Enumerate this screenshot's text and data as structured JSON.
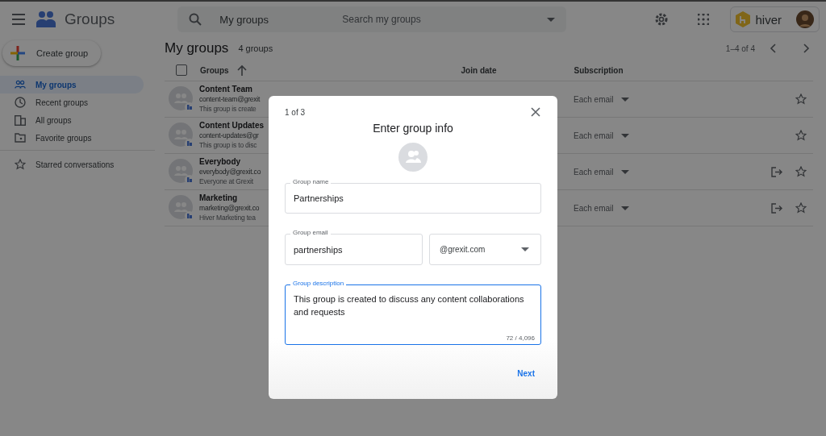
{
  "app": {
    "title": "Groups"
  },
  "search": {
    "scope": "My groups",
    "placeholder": "Search my groups"
  },
  "account": {
    "brand": "hiver"
  },
  "create_button": "Create group",
  "sidebar": {
    "items": [
      {
        "label": "My groups",
        "selected": true
      },
      {
        "label": "Recent groups",
        "selected": false
      },
      {
        "label": "All groups",
        "selected": false
      },
      {
        "label": "Favorite groups",
        "selected": false
      },
      {
        "label": "Starred conversations",
        "selected": false
      }
    ]
  },
  "page": {
    "title": "My groups",
    "count": "4 groups",
    "pagination": "1–4 of 4"
  },
  "table": {
    "columns": [
      "Groups",
      "Join date",
      "Subscription"
    ],
    "select_all": {
      "checked": false
    },
    "rows": [
      {
        "name": "Content Team",
        "email": "content-team@grexit",
        "description": "This group is create",
        "subscription": "Each email",
        "leave": false
      },
      {
        "name": "Content Updates",
        "email": "content-updates@gr",
        "description": "This group is to disc",
        "subscription": "Each email",
        "leave": false
      },
      {
        "name": "Everybody",
        "email": "everybody@grexit.co",
        "description": "Everyone at Grexit",
        "subscription": "Each email",
        "leave": true
      },
      {
        "name": "Marketing",
        "email": "marketing@grexit.co",
        "description": "Hiver Marketing tea",
        "subscription": "Each email",
        "leave": true
      }
    ]
  },
  "dialog": {
    "step": "1 of 3",
    "title": "Enter group info",
    "name_field": {
      "label": "Group name",
      "value": "Partnerships",
      "focused": false
    },
    "email_field": {
      "label": "Group email",
      "value": "partnerships",
      "focused": false
    },
    "domain_select": {
      "value": "@grexit.com"
    },
    "description_field": {
      "label": "Group description",
      "value": "This group is created to discuss any content collaborations and requests",
      "counter": "72 / 4,096",
      "focused": true
    },
    "next_button": "Next"
  }
}
